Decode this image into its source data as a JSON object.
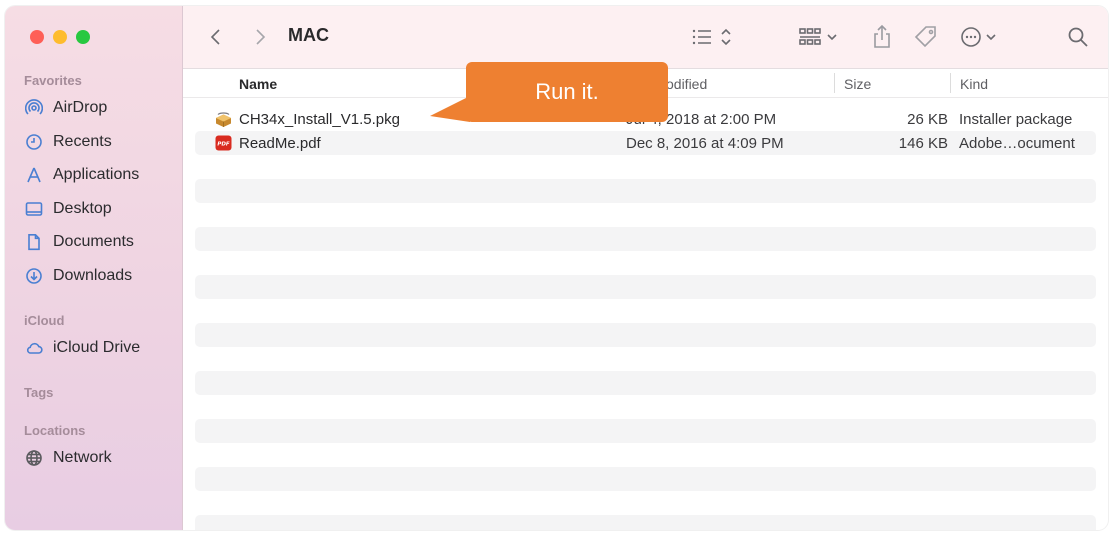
{
  "window": {
    "title": "MAC"
  },
  "sidebar": {
    "favorites_header": "Favorites",
    "icloud_header": "iCloud",
    "tags_header": "Tags",
    "locations_header": "Locations",
    "items": [
      {
        "label": "AirDrop",
        "icon": "airdrop-icon"
      },
      {
        "label": "Recents",
        "icon": "clock-icon"
      },
      {
        "label": "Applications",
        "icon": "applications-icon"
      },
      {
        "label": "Desktop",
        "icon": "desktop-icon"
      },
      {
        "label": "Documents",
        "icon": "document-icon"
      },
      {
        "label": "Downloads",
        "icon": "download-icon"
      },
      {
        "label": "iCloud Drive",
        "icon": "cloud-icon"
      },
      {
        "label": "Network",
        "icon": "globe-icon"
      }
    ]
  },
  "columns": {
    "name": "Name",
    "modified": "odified",
    "size": "Size",
    "kind": "Kind"
  },
  "files": [
    {
      "name": "CH34x_Install_V1.5.pkg",
      "date": "Jul 4, 2018 at 2:00 PM",
      "size": "26 KB",
      "kind": "Installer package",
      "icon": "package-icon"
    },
    {
      "name": "ReadMe.pdf",
      "date": "Dec 8, 2016 at 4:09 PM",
      "size": "146 KB",
      "kind": "Adobe…ocument",
      "icon": "pdf-icon",
      "icon_text": "PDF"
    }
  ],
  "callout": {
    "text": "Run it."
  },
  "colors": {
    "accent": "#4a7fd2",
    "callout": "#ee8031"
  }
}
